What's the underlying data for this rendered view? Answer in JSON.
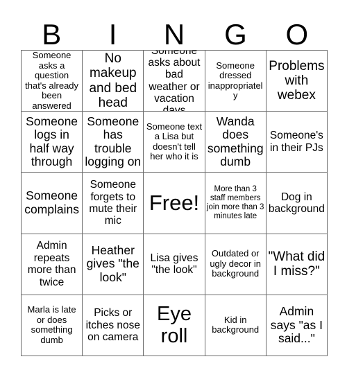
{
  "card": {
    "title": "BINGO",
    "header_letters": [
      "B",
      "I",
      "N",
      "G",
      "O"
    ],
    "free_space_label": "Free!",
    "grid_size": "5x5",
    "border_color": "#6b6b6b",
    "text_color": "#000000",
    "background_color": "#ffffff",
    "rows": [
      [
        {
          "text": "Someone asks a question that's already been answered",
          "size": "fs-sm",
          "free": false
        },
        {
          "text": "No makeup and bed head",
          "size": "fs-xl",
          "free": false
        },
        {
          "text": "Someone asks about bad weather or vacation days",
          "size": "fs-md",
          "free": false
        },
        {
          "text": "Someone dressed inappropriately",
          "size": "fs-sm",
          "free": false
        },
        {
          "text": "Problems with webex",
          "size": "fs-xl",
          "free": false
        }
      ],
      [
        {
          "text": "Someone logs in half way through",
          "size": "fs-lg",
          "free": false
        },
        {
          "text": "Someone has trouble logging on",
          "size": "fs-lg",
          "free": false
        },
        {
          "text": "Someone text a Lisa but doesn't tell her who it is",
          "size": "fs-sm",
          "free": false
        },
        {
          "text": "Wanda does something dumb",
          "size": "fs-lg",
          "free": false
        },
        {
          "text": "Someone's in their PJs",
          "size": "fs-md",
          "free": false
        }
      ],
      [
        {
          "text": "Someone complains",
          "size": "fs-lg",
          "free": false
        },
        {
          "text": "Someone forgets to mute their mic",
          "size": "fs-md",
          "free": false
        },
        {
          "text": "Free!",
          "size": "fs-free",
          "free": true
        },
        {
          "text": "More than 3 staff members join more than 3 minutes late",
          "size": "fs-xs",
          "free": false
        },
        {
          "text": "Dog in background",
          "size": "fs-md",
          "free": false
        }
      ],
      [
        {
          "text": "Admin repeats more than twice",
          "size": "fs-md",
          "free": false
        },
        {
          "text": "Heather gives \"the look\"",
          "size": "fs-lg",
          "free": false
        },
        {
          "text": "Lisa gives \"the look\"",
          "size": "fs-md",
          "free": false
        },
        {
          "text": "Outdated or ugly decor in background",
          "size": "fs-sm",
          "free": false
        },
        {
          "text": "\"What did I miss?\"",
          "size": "fs-xl",
          "free": false
        }
      ],
      [
        {
          "text": "Marla is late or does something dumb",
          "size": "fs-sm",
          "free": false
        },
        {
          "text": "Picks or itches nose on camera",
          "size": "fs-md",
          "free": false
        },
        {
          "text": "Eye roll",
          "size": "fs-xxl",
          "free": false
        },
        {
          "text": "Kid in background",
          "size": "fs-sm",
          "free": false
        },
        {
          "text": "Admin says \"as I said...\"",
          "size": "fs-lg",
          "free": false
        }
      ]
    ]
  }
}
